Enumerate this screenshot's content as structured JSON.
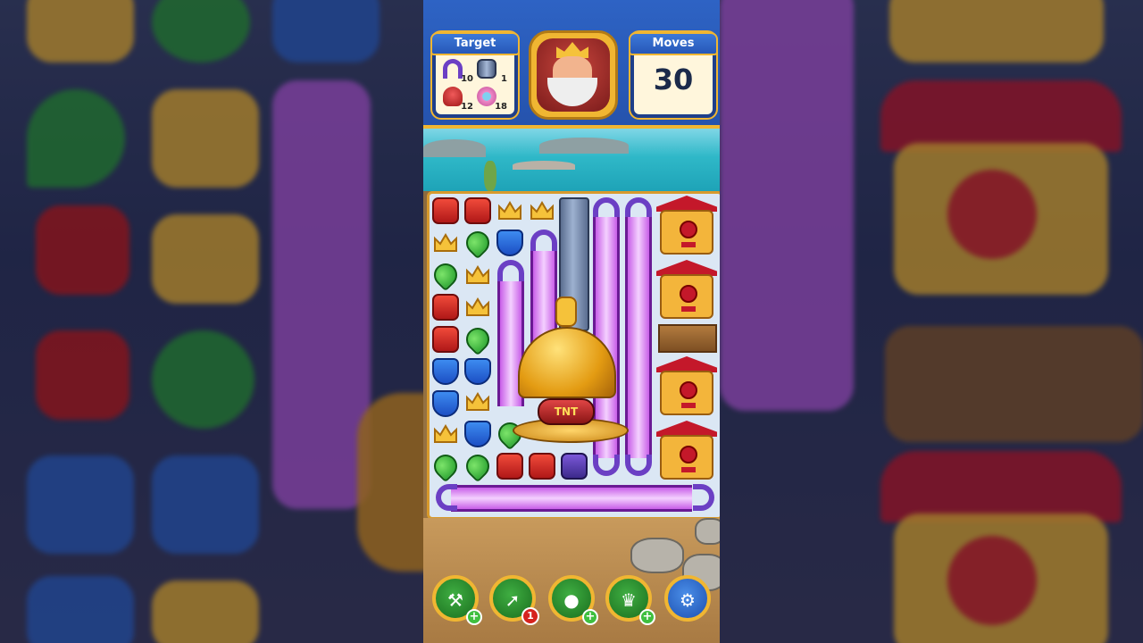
{
  "hud": {
    "target_label": "Target",
    "moves_label": "Moves",
    "moves_value": "30",
    "targets": [
      {
        "icon": "magnet-icon",
        "count": "10"
      },
      {
        "icon": "pipe-icon",
        "count": "1"
      },
      {
        "icon": "red-monster-icon",
        "count": "12"
      },
      {
        "icon": "pink-flower-icon",
        "count": "18"
      }
    ],
    "character": "king-avatar"
  },
  "board": {
    "tnt_label": "TNT"
  },
  "boosters": [
    {
      "name": "hammer-booster",
      "badge": "+"
    },
    {
      "name": "arrow-booster",
      "badge": "1"
    },
    {
      "name": "cannon-booster",
      "badge": "+"
    },
    {
      "name": "jester-hat-booster",
      "badge": "+"
    },
    {
      "name": "settings-button",
      "badge": ""
    }
  ],
  "colors": {
    "accent_gold": "#f0b632",
    "hud_blue": "#2e63c4",
    "laser_purple": "#c85ee8"
  }
}
